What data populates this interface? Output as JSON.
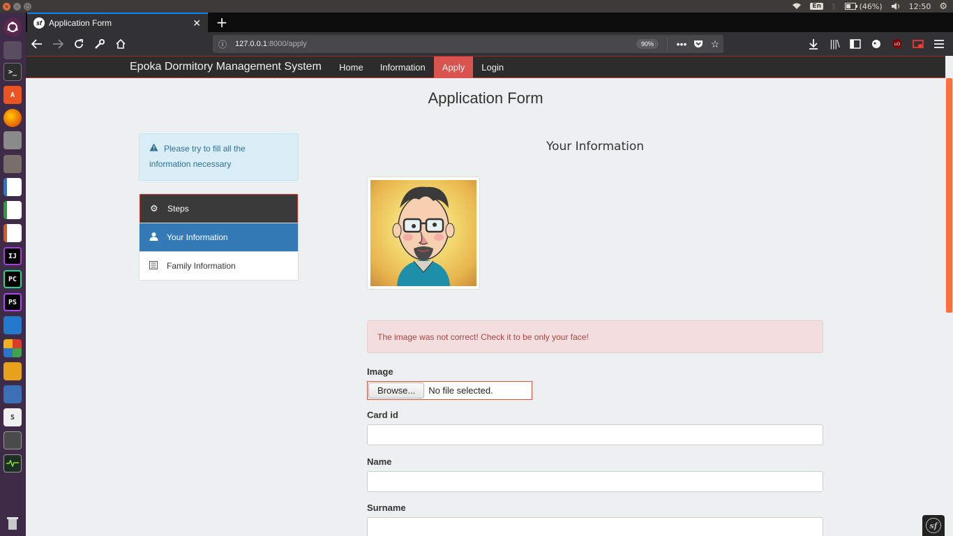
{
  "system_panel": {
    "keyboard_layout": "En",
    "battery": "(46%)",
    "clock": "12:50"
  },
  "launcher": {
    "apps": [
      {
        "name": "ubuntu-dash-icon",
        "color": "#5e2750"
      },
      {
        "name": "files-icon",
        "color": "#5a4d61"
      },
      {
        "name": "terminal-icon",
        "color": "#2e2e2e"
      },
      {
        "name": "software-center-icon",
        "color": "#e95420"
      },
      {
        "name": "firefox-icon",
        "color": "#e66000"
      },
      {
        "name": "disk-icon",
        "color": "#8a8a8a"
      },
      {
        "name": "archive-icon",
        "color": "#7a6f68"
      },
      {
        "name": "writer-icon",
        "color": "#2a76c8"
      },
      {
        "name": "calc-icon",
        "color": "#2d9c3a"
      },
      {
        "name": "impress-icon",
        "color": "#d35a26"
      },
      {
        "name": "intellij-icon",
        "color": "#a93cd4"
      },
      {
        "name": "pycharm-icon",
        "color": "#21d789"
      },
      {
        "name": "phpstorm-icon",
        "color": "#b345f1"
      },
      {
        "name": "vscode-icon",
        "color": "#2379cc"
      },
      {
        "name": "app-grid-icon",
        "color": "#d93c2a"
      },
      {
        "name": "network-tool-icon",
        "color": "#e7a11a"
      },
      {
        "name": "wireshark-icon",
        "color": "#3b6fb6"
      },
      {
        "name": "sublime-icon",
        "color": "#f0f0f0"
      },
      {
        "name": "remote-desktop-icon",
        "color": "#4a4a4a"
      },
      {
        "name": "system-monitor-icon",
        "color": "#3d6b4a"
      },
      {
        "name": "trash-icon",
        "color": "#888888"
      }
    ],
    "labels": {
      "terminal": ">_",
      "intellij": "IJ",
      "pycharm": "PC",
      "phpstorm": "PS",
      "sublime": "S"
    }
  },
  "browser": {
    "tab_title": "Application Form",
    "url_host": "127.0.0.1",
    "url_rest": ":8000/apply",
    "zoom": "90%"
  },
  "site": {
    "brand": "Epoka Dormitory Management System",
    "menu": [
      "Home",
      "Information",
      "Apply",
      "Login"
    ],
    "active_menu": "Apply",
    "page_title": "Application Form",
    "info_alert": "Please try to fill all the information necessary",
    "steps": {
      "header": "Steps",
      "items": [
        "Your Information",
        "Family Information"
      ]
    },
    "section_title": "Your Information",
    "error_alert": "The image was not correct! Check it to be only your face!",
    "form": {
      "image_label": "Image",
      "browse_label": "Browse...",
      "file_status": "No file selected.",
      "card_id_label": "Card id",
      "card_id_value": "",
      "name_label": "Name",
      "name_value": "",
      "surname_label": "Surname",
      "surname_value": ""
    },
    "colors": {
      "accent_red": "#d9534f",
      "primary_blue": "#337ab7",
      "navbar_dark": "#2c2c2c",
      "page_bg": "#ecf0f1"
    }
  },
  "symfony_toolbar": {
    "logo_text": "sf"
  }
}
